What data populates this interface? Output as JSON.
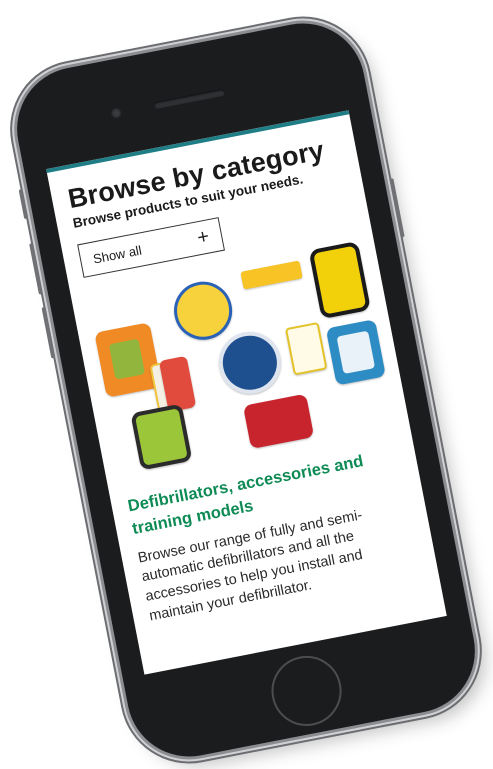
{
  "page": {
    "title": "Browse by category",
    "subtitle": "Browse products to suit your needs."
  },
  "filter": {
    "show_all_label": "Show all",
    "show_all_icon": "plus-icon",
    "show_all_glyph": "+"
  },
  "category_card": {
    "title": "Defibrillators, accessories and training models",
    "description": "Browse our range of fully and semi-automatic defibrillators and all the accessories to help you install and maintain your defibrillator."
  },
  "colors": {
    "accent_green": "#0e8b55",
    "top_bar_teal": "#1f7d86",
    "text_dark": "#1a1a1a"
  }
}
